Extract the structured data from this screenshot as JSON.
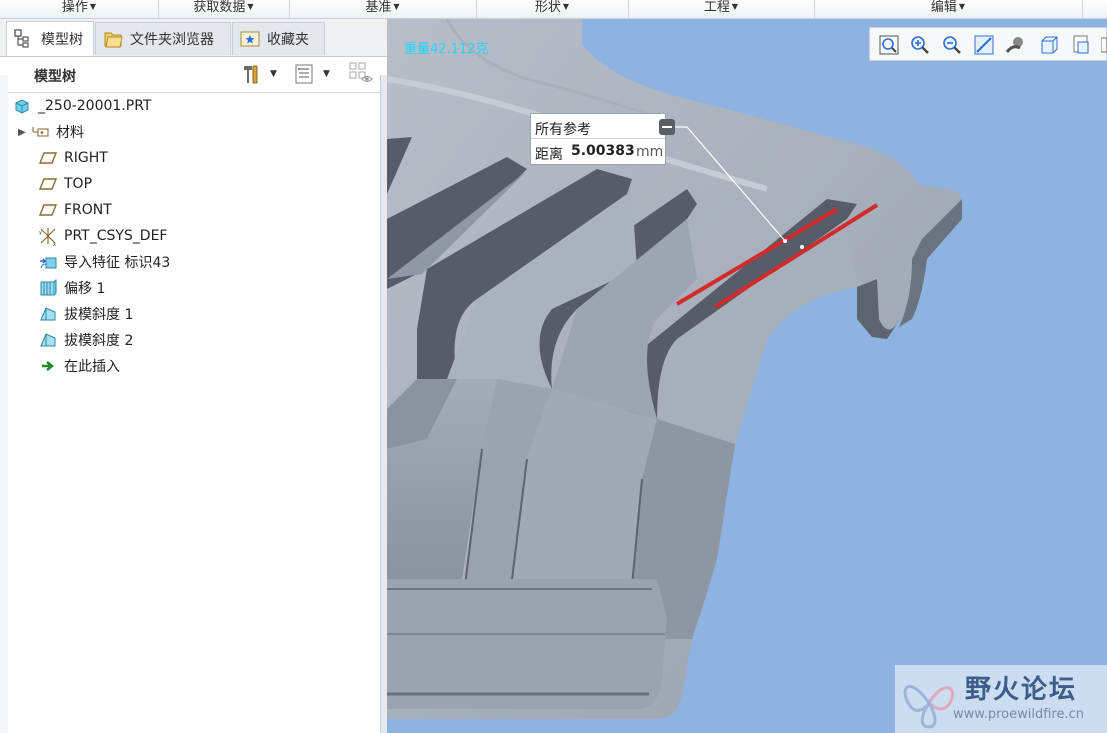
{
  "ribbon": {
    "groups": [
      {
        "label": "操作"
      },
      {
        "label": "获取数据"
      },
      {
        "label": "基准"
      },
      {
        "label": "形状"
      },
      {
        "label": "工程"
      },
      {
        "label": "编辑"
      }
    ]
  },
  "left_panel": {
    "tabs": [
      {
        "label": "模型树",
        "active": true
      },
      {
        "label": "文件夹浏览器",
        "active": false
      },
      {
        "label": "收藏夹",
        "active": false
      }
    ],
    "tree_header": "模型树",
    "tree": [
      {
        "label": "_250-20001.PRT",
        "icon": "part-icon"
      },
      {
        "label": "材料",
        "icon": "material-icon",
        "expandable": true
      },
      {
        "label": "RIGHT",
        "icon": "datum-plane-icon"
      },
      {
        "label": "TOP",
        "icon": "datum-plane-icon"
      },
      {
        "label": "FRONT",
        "icon": "datum-plane-icon"
      },
      {
        "label": "PRT_CSYS_DEF",
        "icon": "csys-icon"
      },
      {
        "label": "导入特征 标识43",
        "icon": "import-feature-icon"
      },
      {
        "label": "偏移 1",
        "icon": "offset-icon"
      },
      {
        "label": "拔模斜度 1",
        "icon": "draft-icon"
      },
      {
        "label": "拔模斜度 2",
        "icon": "draft-icon"
      },
      {
        "label": "在此插入",
        "icon": "insert-here-icon"
      }
    ]
  },
  "viewport": {
    "weight_label": "重量42.112克",
    "measure": {
      "header": "所有参考",
      "label": "距离",
      "value": "5.00383",
      "unit": "mm"
    },
    "highlight_color": "#d22b2b",
    "background_color": "#8eb3e1"
  },
  "watermark": {
    "title": "野火论坛",
    "url": "www.proewildfire.cn"
  }
}
